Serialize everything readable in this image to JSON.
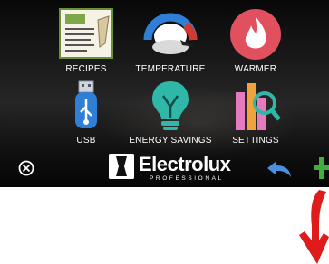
{
  "menu": {
    "items": [
      {
        "label": "RECIPES",
        "icon": "recipes-icon"
      },
      {
        "label": "TEMPERATURE",
        "icon": "temperature-icon"
      },
      {
        "label": "WARMER",
        "icon": "flame-icon"
      },
      {
        "label": "USB",
        "icon": "usb-icon"
      },
      {
        "label": "ENERGY SAVINGS",
        "icon": "lightbulb-icon"
      },
      {
        "label": "SETTINGS",
        "icon": "settings-icon"
      }
    ]
  },
  "bottom_bar": {
    "close_icon": "close-icon",
    "back_icon": "back-arrow-icon",
    "add_icon": "plus-icon"
  },
  "brand": {
    "name": "Electrolux",
    "subtitle": "PROFESSIONAL"
  },
  "colors": {
    "warmer_red": "#e0505f",
    "energy_teal": "#2fb7a8",
    "usb_blue": "#2f7fd6",
    "plus_green": "#3fae3a",
    "pointer_red": "#e01b1b"
  }
}
